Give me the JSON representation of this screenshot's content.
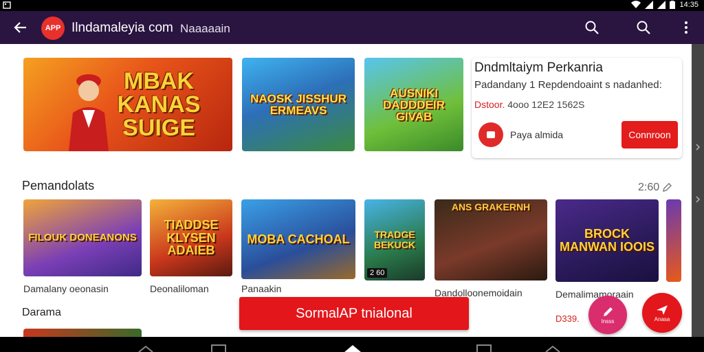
{
  "status_bar": {
    "time": "14:35"
  },
  "app_bar": {
    "logo_text": "APP",
    "title": "Ilndamaleyia com",
    "subtitle": "Naaaaain"
  },
  "banners": [
    {
      "text": "MBAK KANAS SUIGE"
    },
    {
      "text": "NAOSK JISSHUR ERMEAVS"
    },
    {
      "text": "AUSNIKI DADDDEIR GIVAB"
    }
  ],
  "info_card": {
    "title": "Dndmltaiym Perkanria",
    "description": "Padandany 1 Repdendoaint s nadanhed:",
    "meta_label": "Dstoor.",
    "meta_value": "4ooo  12E2 1562S",
    "publisher": "Paya almida",
    "connect_label": "Connroon"
  },
  "section1": {
    "title": "Pemandolats",
    "meta": "2:60"
  },
  "tiles": [
    {
      "text": "FILOUK DONEANONS",
      "label": "Damalany oeonasin"
    },
    {
      "text": "TIADDSE KLYSEN ADAIEB",
      "label": "Deonaliloman"
    },
    {
      "text": "MOBA CACHOAL",
      "label": "Panaakin"
    },
    {
      "text": "TRADGE BEKUCK",
      "label": "",
      "badge": "2 60"
    },
    {
      "text": "ANS GRAKERNH",
      "label": "Dandolloonemoidain"
    },
    {
      "text": "BROCK MANWAN IOOIS",
      "label": "Demalimamoraain"
    },
    {
      "text": "",
      "label": ""
    }
  ],
  "section2": {
    "title": "Darama"
  },
  "price": "D339.",
  "cta_label": "SormalАP  tnialonal",
  "fab1_label": "Insss",
  "fab2_label": "Anasa",
  "colors": {
    "app_bar": "#2a1440",
    "accent_red": "#e3161b",
    "fab_pink": "#d92d6e"
  }
}
